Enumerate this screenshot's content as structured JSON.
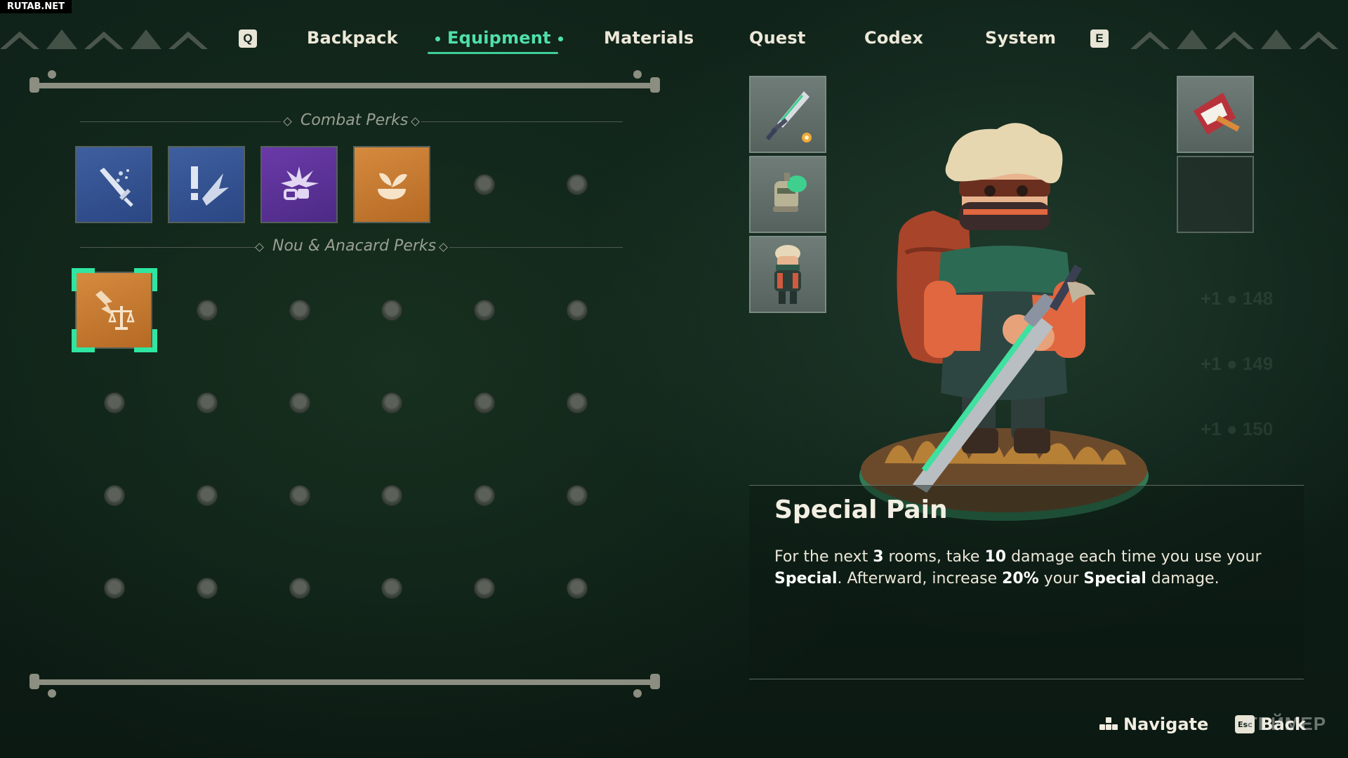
{
  "watermark": "RUTAB.NET",
  "nav": {
    "left_key": "Q",
    "right_key": "E",
    "tabs": [
      {
        "label": "Backpack",
        "active": false
      },
      {
        "label": "Equipment",
        "active": true
      },
      {
        "label": "Materials",
        "active": false
      },
      {
        "label": "Quest",
        "active": false
      },
      {
        "label": "Codex",
        "active": false
      },
      {
        "label": "System",
        "active": false
      }
    ],
    "accent_color": "#4fe0a8"
  },
  "perks": {
    "combat_title": "Combat Perks",
    "combat_icons": [
      "sword-sparkle-icon",
      "exclamation-slash-icon",
      "burst-chain-icon",
      "sprout-icon"
    ],
    "companion_title": "Nou & Anacard Perks",
    "companion_icons": [
      "balance-scale-icon"
    ],
    "selected_perk_icon": "balance-scale-icon"
  },
  "equipment": {
    "slots": [
      "greatsword-icon",
      "lantern-gear-icon",
      "character-outfit-icon"
    ],
    "trinket_slots": [
      "red-pennant-icon",
      ""
    ]
  },
  "description": {
    "title": "Special Pain",
    "text_parts": [
      {
        "t": "For the next ",
        "b": false
      },
      {
        "t": "3",
        "b": true
      },
      {
        "t": " rooms, take ",
        "b": false
      },
      {
        "t": "10",
        "b": true
      },
      {
        "t": " damage each time you use your ",
        "b": false
      },
      {
        "t": "Special",
        "b": true
      },
      {
        "t": ". Afterward, increase ",
        "b": false
      },
      {
        "t": "20%",
        "b": true
      },
      {
        "t": " your ",
        "b": false
      },
      {
        "t": "Special",
        "b": true
      },
      {
        "t": " damage.",
        "b": false
      }
    ]
  },
  "hints": {
    "navigate_label": "Navigate",
    "back_key": "Esc",
    "back_label": "Back"
  },
  "background_numbers": [
    "+1 ● 148",
    "+1 ● 149",
    "+1 ● 150"
  ],
  "brand_watermark": "ГЕЙМЕР"
}
